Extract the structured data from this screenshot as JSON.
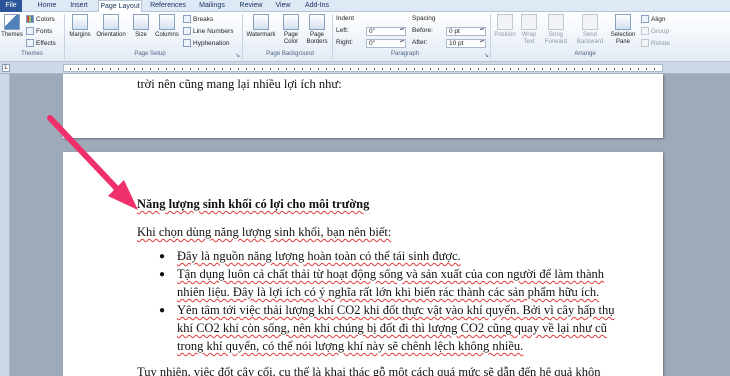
{
  "tabs": [
    "File",
    "Home",
    "Insert",
    "Page Layout",
    "References",
    "Mailings",
    "Review",
    "View",
    "Add-Ins"
  ],
  "ribbon": {
    "themes": {
      "themes_label": "Themes",
      "colors": "Colors",
      "fonts": "Fonts",
      "effects": "Effects",
      "group": "Themes"
    },
    "page_setup": {
      "margins": "Margins",
      "orientation": "Orientation",
      "size": "Size",
      "columns": "Columns",
      "breaks": "Breaks",
      "line_numbers": "Line Numbers",
      "hyphenation": "Hyphenation",
      "group": "Page Setup"
    },
    "page_background": {
      "watermark": "Watermark",
      "page_color": "Page Color",
      "page_borders": "Page Borders",
      "group": "Page Background"
    },
    "paragraph": {
      "indent": "Indent",
      "left_label": "Left:",
      "left_value": "0\"",
      "right_label": "Right:",
      "right_value": "0\"",
      "spacing": "Spacing",
      "before_label": "Before:",
      "before_value": "0 pt",
      "after_label": "After:",
      "after_value": "10 pt",
      "group": "Paragraph"
    },
    "arrange": {
      "position": "Position",
      "wrap_text": "Wrap Text",
      "bring_forward": "Bring Forward",
      "send_backward": "Send Backward",
      "selection_pane": "Selection Pane",
      "align": "Align",
      "group_btn": "Group",
      "rotate": "Rotate",
      "group": "Arrange"
    }
  },
  "document": {
    "page1_line": "trời nên cũng mang lại nhiều lợi ích như:",
    "heading": "Năng lượng sinh khối có lợi cho môi trường",
    "intro": "Khi chọn dùng năng lượng sinh khối, bạn nên biết:",
    "bullets": [
      {
        "lines": [
          "Đây là nguồn năng lượng hoàn toàn có thể tái sinh được."
        ]
      },
      {
        "lines": [
          "Tận dụng luôn cả chất thải từ hoạt động sống và sản xuất của con người để làm thành",
          "nhiên liệu. Đây là lợi ích có ý nghĩa rất lớn khi biến rác thành các sản phẩm hữu ích."
        ]
      },
      {
        "lines": [
          "Yên tâm tới việc thải lượng khí CO2 khi đốt thực vật vào khí quyển. Bởi vì cây hấp thụ",
          "khí CO2 khi còn sống, nên khi chúng bị đốt đi thì lượng CO2 cũng quay về lại như cũ",
          "trong khí quyển, có thể nói lượng khí này sẽ chênh lệch không nhiều."
        ]
      }
    ],
    "closing": "Tuy nhiên, việc đốt cây cối, cụ thể là khai thác gỗ một cách quá mức sẽ dẫn đến hệ quả khôn"
  },
  "colors": {
    "file_tab": "#2b579a",
    "arrow": "#f0306a",
    "spelling_underline": "#e23a3a"
  }
}
